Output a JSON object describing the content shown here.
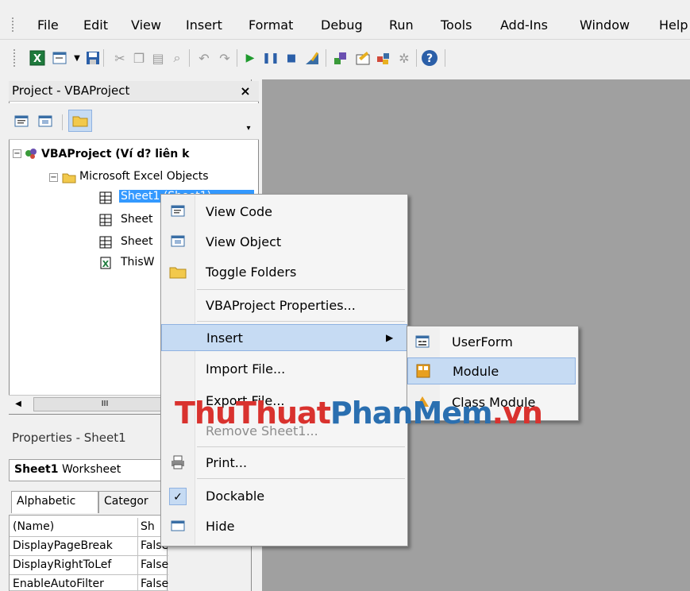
{
  "menubar": {
    "items": [
      {
        "label": "File"
      },
      {
        "label": "Edit"
      },
      {
        "label": "View"
      },
      {
        "label": "Insert"
      },
      {
        "label": "Format"
      },
      {
        "label": "Debug"
      },
      {
        "label": "Run"
      },
      {
        "label": "Tools"
      },
      {
        "label": "Add-Ins"
      },
      {
        "label": "Window"
      },
      {
        "label": "Help"
      }
    ]
  },
  "toolbar": {
    "icons": [
      "excel-icon",
      "insert-userform-icon",
      "save-icon",
      "cut-icon",
      "copy-icon",
      "paste-icon",
      "find-icon",
      "undo-icon",
      "redo-icon",
      "run-icon",
      "break-icon",
      "reset-icon",
      "design-mode-icon",
      "project-explorer-icon",
      "properties-icon",
      "object-browser-icon",
      "toolbox-icon",
      "help-icon"
    ]
  },
  "project": {
    "title": "Project - VBAProject",
    "close": "×",
    "tree": {
      "root": "VBAProject (Ví d? liên k",
      "folder": "Microsoft Excel Objects",
      "items": [
        "Sheet1 (Sheet1)",
        "Sheet",
        "Sheet",
        "ThisW"
      ]
    },
    "scroll_glyph": "III"
  },
  "properties": {
    "title": "Properties - Sheet1",
    "object_name": "Sheet1",
    "object_type": "Worksheet",
    "tabs": [
      "Alphabetic",
      "Categor"
    ],
    "rows": [
      {
        "name": "(Name)",
        "value": "Sh"
      },
      {
        "name": "DisplayPageBreak",
        "value": "False"
      },
      {
        "name": "DisplayRightToLef",
        "value": "False"
      },
      {
        "name": "EnableAutoFilter",
        "value": "False"
      }
    ]
  },
  "context_menu": {
    "items": [
      {
        "label": "View Code"
      },
      {
        "label": "View Object"
      },
      {
        "label": "Toggle Folders"
      },
      {
        "label": "VBAProject Properties..."
      },
      {
        "label": "Insert"
      },
      {
        "label": "Import File..."
      },
      {
        "label": "Export File..."
      },
      {
        "label": "Remove Sheet1..."
      },
      {
        "label": "Print..."
      },
      {
        "label": "Dockable"
      },
      {
        "label": "Hide"
      }
    ],
    "arrow": "▶",
    "check": "✓"
  },
  "submenu": {
    "items": [
      {
        "label": "UserForm"
      },
      {
        "label": "Module"
      },
      {
        "label": "Class Module"
      }
    ]
  },
  "watermark": {
    "part1": "ThuThuat",
    "part2": "PhanMem",
    "part3": ".vn"
  },
  "colors": {
    "highlight": "#c6dbf3",
    "workspace": "#a0a0a0",
    "watermark_red": "#d9322e",
    "watermark_blue": "#2a6fb0"
  }
}
